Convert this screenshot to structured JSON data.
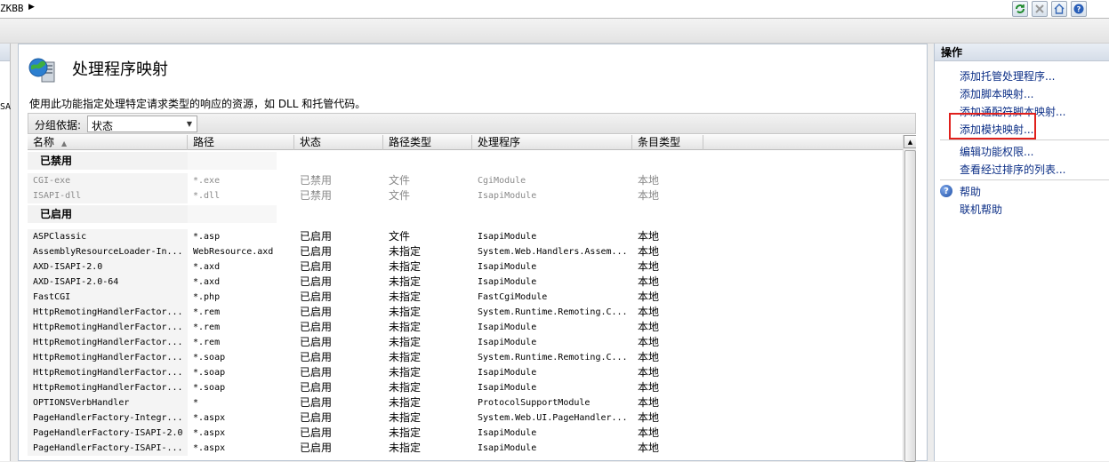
{
  "topbar": {
    "breadcrumb": "ZKBB",
    "breadcrumb_arrow": "▶",
    "icons": [
      "refresh-icon",
      "stop-icon",
      "home-icon",
      "help-icon"
    ]
  },
  "left_strip": {
    "tag": "SA"
  },
  "page": {
    "title": "处理程序映射",
    "description": "使用此功能指定处理特定请求类型的响应的资源，如 DLL 和托管代码。",
    "group_by_label": "分组依据:",
    "group_by_value": "状态"
  },
  "columns": [
    "名称",
    "路径",
    "状态",
    "路径类型",
    "处理程序",
    "条目类型"
  ],
  "groups": [
    {
      "label": "已禁用",
      "disabled": true,
      "rows": [
        [
          "CGI-exe",
          "*.exe",
          "已禁用",
          "文件",
          "CgiModule",
          "本地"
        ],
        [
          "ISAPI-dll",
          "*.dll",
          "已禁用",
          "文件",
          "IsapiModule",
          "本地"
        ]
      ]
    },
    {
      "label": "已启用",
      "disabled": false,
      "rows": [
        [
          "ASPClassic",
          "*.asp",
          "已启用",
          "文件",
          "IsapiModule",
          "本地"
        ],
        [
          "AssemblyResourceLoader-In...",
          "WebResource.axd",
          "已启用",
          "未指定",
          "System.Web.Handlers.Assem...",
          "本地"
        ],
        [
          "AXD-ISAPI-2.0",
          "*.axd",
          "已启用",
          "未指定",
          "IsapiModule",
          "本地"
        ],
        [
          "AXD-ISAPI-2.0-64",
          "*.axd",
          "已启用",
          "未指定",
          "IsapiModule",
          "本地"
        ],
        [
          "FastCGI",
          "*.php",
          "已启用",
          "未指定",
          "FastCgiModule",
          "本地"
        ],
        [
          "HttpRemotingHandlerFactor...",
          "*.rem",
          "已启用",
          "未指定",
          "System.Runtime.Remoting.C...",
          "本地"
        ],
        [
          "HttpRemotingHandlerFactor...",
          "*.rem",
          "已启用",
          "未指定",
          "IsapiModule",
          "本地"
        ],
        [
          "HttpRemotingHandlerFactor...",
          "*.rem",
          "已启用",
          "未指定",
          "IsapiModule",
          "本地"
        ],
        [
          "HttpRemotingHandlerFactor...",
          "*.soap",
          "已启用",
          "未指定",
          "System.Runtime.Remoting.C...",
          "本地"
        ],
        [
          "HttpRemotingHandlerFactor...",
          "*.soap",
          "已启用",
          "未指定",
          "IsapiModule",
          "本地"
        ],
        [
          "HttpRemotingHandlerFactor...",
          "*.soap",
          "已启用",
          "未指定",
          "IsapiModule",
          "本地"
        ],
        [
          "OPTIONSVerbHandler",
          "*",
          "已启用",
          "未指定",
          "ProtocolSupportModule",
          "本地"
        ],
        [
          "PageHandlerFactory-Integr...",
          "*.aspx",
          "已启用",
          "未指定",
          "System.Web.UI.PageHandler...",
          "本地"
        ],
        [
          "PageHandlerFactory-ISAPI-2.0",
          "*.aspx",
          "已启用",
          "未指定",
          "IsapiModule",
          "本地"
        ],
        [
          "PageHandlerFactory-ISAPI-...",
          "*.aspx",
          "已启用",
          "未指定",
          "IsapiModule",
          "本地"
        ]
      ]
    }
  ],
  "actions": {
    "title": "操作",
    "items": [
      "添加托管处理程序...",
      "添加脚本映射...",
      "添加通配符脚本映射...",
      "添加模块映射..."
    ],
    "items2": [
      "编辑功能权限...",
      "查看经过排序的列表..."
    ],
    "help": "帮助",
    "online_help": "联机帮助"
  },
  "colors": {
    "highlight": "#e0201c",
    "link": "#0b2e86",
    "disabled_text": "#8a8a8a"
  }
}
